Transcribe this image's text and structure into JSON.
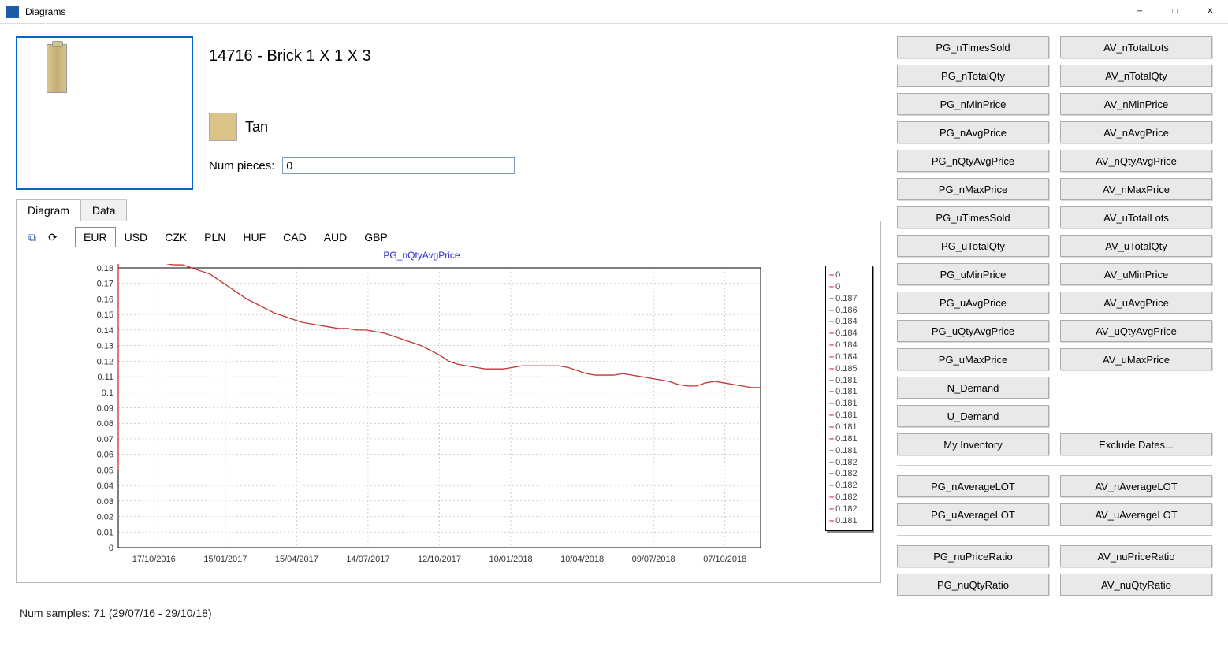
{
  "window": {
    "title": "Diagrams"
  },
  "item": {
    "title": "14716 - Brick 1 X 1 X 3",
    "color_name": "Tan",
    "color_hex": "#dcc38a",
    "num_pieces_label": "Num pieces:",
    "num_pieces_value": "0"
  },
  "tabs": {
    "diagram": "Diagram",
    "data": "Data"
  },
  "currencies": [
    "EUR",
    "USD",
    "CZK",
    "PLN",
    "HUF",
    "CAD",
    "AUD",
    "GBP"
  ],
  "currency_active": "EUR",
  "chart_data": {
    "type": "line",
    "title": "PG_nQtyAvgPrice",
    "xlabel": "",
    "ylabel": "",
    "ylim": [
      0,
      0.18
    ],
    "yticks": [
      0,
      0.01,
      0.02,
      0.03,
      0.04,
      0.05,
      0.06,
      0.07,
      0.08,
      0.09,
      0.1,
      0.11,
      0.12,
      0.13,
      0.14,
      0.15,
      0.16,
      0.17,
      0.18
    ],
    "xticks": [
      "17/10/2016",
      "15/01/2017",
      "15/04/2017",
      "14/07/2017",
      "12/10/2017",
      "10/01/2018",
      "10/04/2018",
      "09/07/2018",
      "07/10/2018"
    ],
    "series": [
      {
        "name": "PG_nQtyAvgPrice",
        "color": "#c83232",
        "values": [
          0.185,
          0.184,
          0.184,
          0.183,
          0.183,
          0.183,
          0.182,
          0.182,
          0.18,
          0.178,
          0.176,
          0.172,
          0.168,
          0.164,
          0.16,
          0.157,
          0.154,
          0.151,
          0.149,
          0.147,
          0.145,
          0.144,
          0.143,
          0.142,
          0.141,
          0.141,
          0.14,
          0.14,
          0.139,
          0.138,
          0.136,
          0.134,
          0.132,
          0.13,
          0.127,
          0.124,
          0.12,
          0.118,
          0.117,
          0.116,
          0.115,
          0.115,
          0.115,
          0.116,
          0.117,
          0.117,
          0.117,
          0.117,
          0.117,
          0.116,
          0.114,
          0.112,
          0.111,
          0.111,
          0.111,
          0.112,
          0.111,
          0.11,
          0.109,
          0.108,
          0.107,
          0.105,
          0.104,
          0.104,
          0.106,
          0.107,
          0.106,
          0.105,
          0.104,
          0.103,
          0.103
        ]
      }
    ],
    "legend_values": [
      "0",
      "0",
      "0.187",
      "0.186",
      "0.184",
      "0.184",
      "0.184",
      "0.184",
      "0.185",
      "0.181",
      "0.181",
      "0.181",
      "0.181",
      "0.181",
      "0.181",
      "0.181",
      "0.182",
      "0.182",
      "0.182",
      "0.182",
      "0.182",
      "0.181"
    ]
  },
  "buttons": {
    "section1_left": [
      "PG_nTimesSold",
      "PG_nTotalQty",
      "PG_nMinPrice",
      "PG_nAvgPrice",
      "PG_nQtyAvgPrice",
      "PG_nMaxPrice",
      "PG_uTimesSold",
      "PG_uTotalQty",
      "PG_uMinPrice",
      "PG_uAvgPrice",
      "PG_uQtyAvgPrice",
      "PG_uMaxPrice",
      "N_Demand",
      "U_Demand",
      "My Inventory"
    ],
    "section1_right": [
      "AV_nTotalLots",
      "AV_nTotalQty",
      "AV_nMinPrice",
      "AV_nAvgPrice",
      "AV_nQtyAvgPrice",
      "AV_nMaxPrice",
      "AV_uTotalLots",
      "AV_uTotalQty",
      "AV_uMinPrice",
      "AV_uAvgPrice",
      "AV_uQtyAvgPrice",
      "AV_uMaxPrice",
      "",
      "",
      "Exclude Dates..."
    ],
    "section2_left": [
      "PG_nAverageLOT",
      "PG_uAverageLOT"
    ],
    "section2_right": [
      "AV_nAverageLOT",
      "AV_uAverageLOT"
    ],
    "section3_left": [
      "PG_nuPriceRatio",
      "PG_nuQtyRatio"
    ],
    "section3_right": [
      "AV_nuPriceRatio",
      "AV_nuQtyRatio"
    ]
  },
  "status": "Num samples: 71 (29/07/16 - 29/10/18)"
}
